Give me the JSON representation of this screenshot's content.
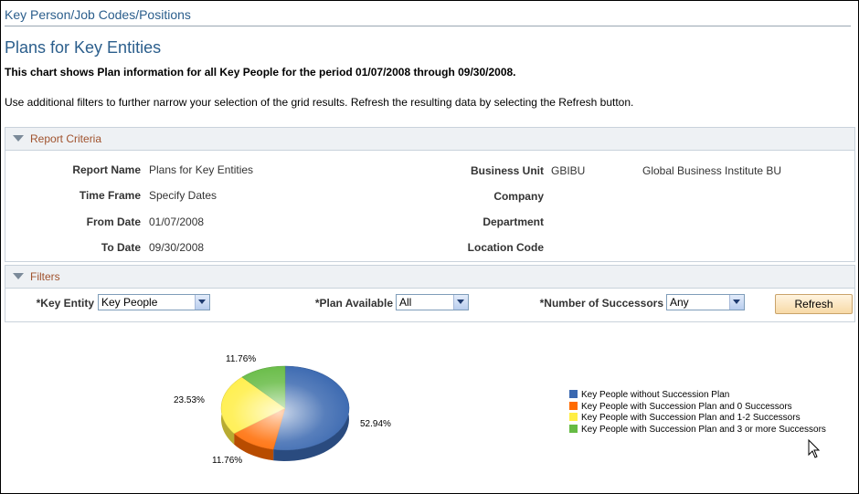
{
  "breadcrumb": "Key Person/Job Codes/Positions",
  "page_title": "Plans for Key Entities",
  "description_bold": "This chart shows Plan information for all Key People for the period 01/07/2008 through 09/30/2008.",
  "description": "Use additional filters to further narrow your selection of the grid results. Refresh the resulting data by selecting the Refresh button.",
  "report_criteria": {
    "title": "Report Criteria",
    "report_name_label": "Report Name",
    "report_name_value": "Plans for Key Entities",
    "time_frame_label": "Time Frame",
    "time_frame_value": "Specify Dates",
    "from_date_label": "From Date",
    "from_date_value": "01/07/2008",
    "to_date_label": "To Date",
    "to_date_value": "09/30/2008",
    "business_unit_label": "Business Unit",
    "business_unit_code": "GBIBU",
    "business_unit_desc": "Global Business Institute BU",
    "company_label": "Company",
    "department_label": "Department",
    "location_code_label": "Location Code"
  },
  "filters": {
    "title": "Filters",
    "key_entity_label": "*Key Entity",
    "key_entity_value": "Key People",
    "plan_available_label": "*Plan Available",
    "plan_available_value": "All",
    "num_successors_label": "*Number of Successors",
    "num_successors_value": "Any",
    "refresh_label": "Refresh"
  },
  "chart_data": {
    "type": "pie",
    "categories": [
      "Key People without Succession Plan",
      "Key People with Succession Plan and 0 Successors",
      "Key People with Succession Plan and 1-2 Successors",
      "Key People with Succession Plan and 3 or more Successors"
    ],
    "values": [
      52.94,
      11.76,
      23.53,
      11.76
    ],
    "value_labels": [
      "52.94%",
      "11.76%",
      "23.53%",
      "11.76%"
    ],
    "colors": [
      "#3a68b0",
      "#ff6a00",
      "#ffee44",
      "#66bb44"
    ],
    "legend_position": "right"
  },
  "icons": {
    "collapse": "triangle-down-icon",
    "dropdown": "chevron-down-icon",
    "cursor": "mouse-pointer-icon"
  }
}
